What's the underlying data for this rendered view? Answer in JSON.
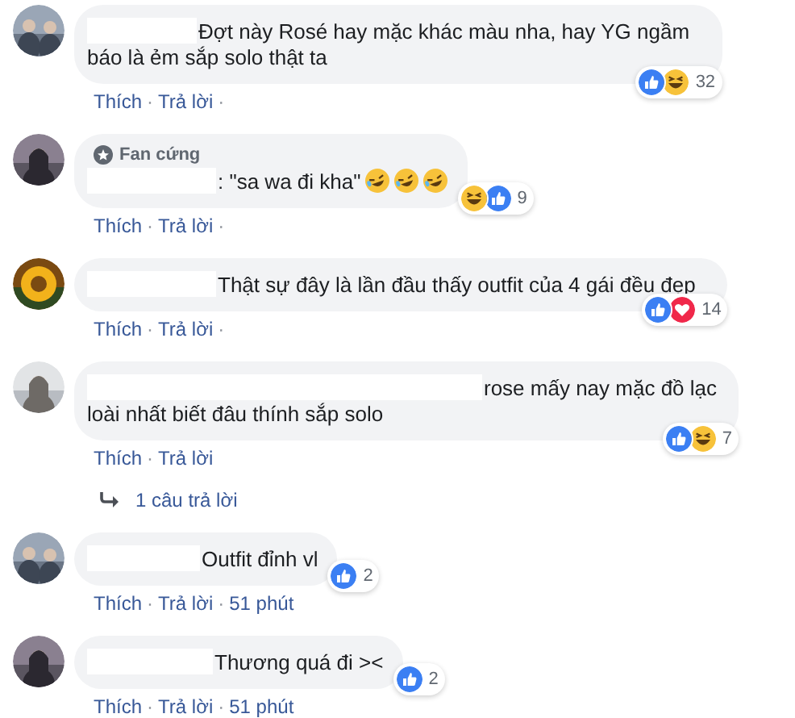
{
  "comments": [
    {
      "lines": [
        "Đợt này Rosé hay mặc khác màu nha, hay YG ngầm",
        "báo là ẻm sắp solo thật ta"
      ],
      "reactions": [
        {
          "kind": "like"
        },
        {
          "kind": "haha"
        }
      ],
      "count": "32",
      "actions": [
        "Thích",
        "Trả lời"
      ],
      "separator": "·",
      "trailing": "·"
    },
    {
      "badge": "Fan cứng",
      "lines": [
        ": \"sa wa đi kha\""
      ],
      "inline_emojis": [
        {
          "kind": "rofl"
        },
        {
          "kind": "rofl"
        },
        {
          "kind": "rofl"
        }
      ],
      "reactions": [
        {
          "kind": "haha"
        },
        {
          "kind": "like"
        }
      ],
      "count": "9",
      "actions": [
        "Thích",
        "Trả lời"
      ],
      "separator": "·",
      "trailing": "·"
    },
    {
      "lines": [
        "Thật sự đây là lần đầu thấy outfit của 4 gái đều đẹp"
      ],
      "reactions": [
        {
          "kind": "like"
        },
        {
          "kind": "love"
        }
      ],
      "count": "14",
      "actions": [
        "Thích",
        "Trả lời"
      ],
      "separator": "·",
      "trailing": "·"
    },
    {
      "lines": [
        "rose mấy nay mặc đồ lạc",
        "loài nhất biết đâu thính sắp solo"
      ],
      "reactions": [
        {
          "kind": "like"
        },
        {
          "kind": "haha"
        }
      ],
      "count": "7",
      "actions": [
        "Thích",
        "Trả lời"
      ],
      "separator": "·",
      "replies": "1 câu trả lời"
    },
    {
      "lines": [
        "Outfit đỉnh vl"
      ],
      "reactions": [
        {
          "kind": "like"
        }
      ],
      "count": "2",
      "actions": [
        "Thích",
        "Trả lời"
      ],
      "separator": "·",
      "time": "51 phút"
    },
    {
      "lines": [
        "Thương quá đi ><"
      ],
      "reactions": [
        {
          "kind": "like"
        }
      ],
      "count": "2",
      "actions": [
        "Thích",
        "Trả lời"
      ],
      "separator": "·",
      "time": "51 phút"
    }
  ]
}
